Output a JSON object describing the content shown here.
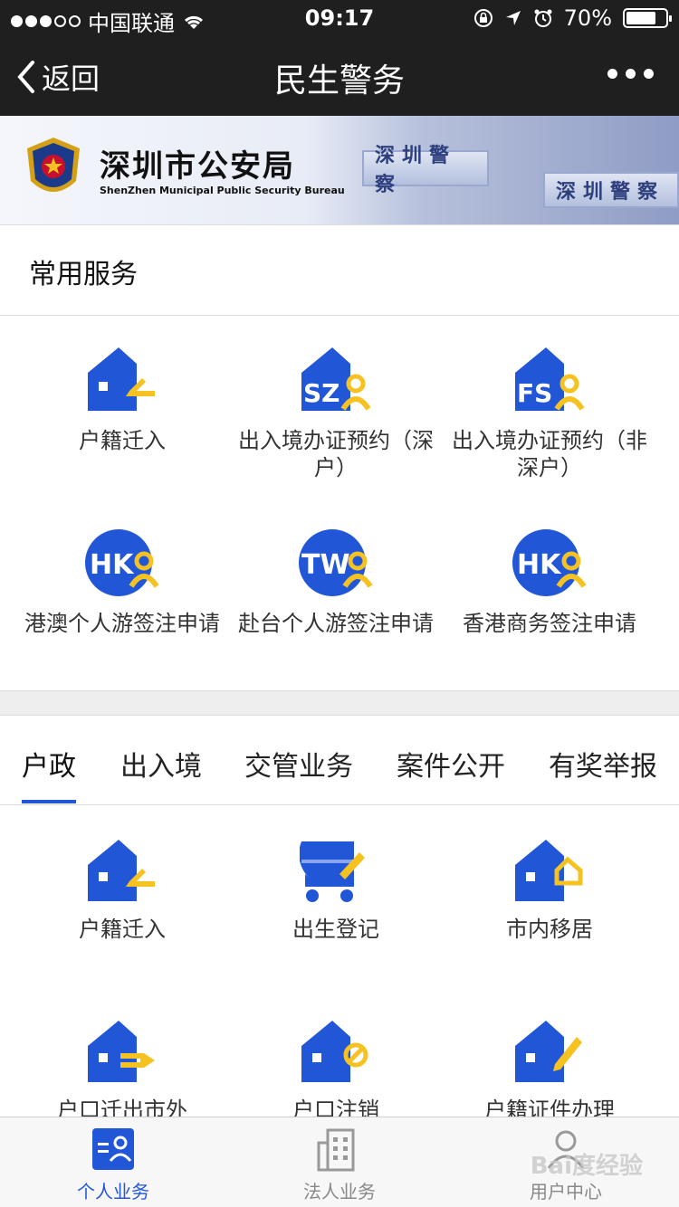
{
  "status_bar": {
    "carrier": "中国联通",
    "time": "09:17",
    "battery": "70%"
  },
  "nav": {
    "back_label": "返回",
    "title": "民生警务"
  },
  "banner": {
    "name_cn": "深圳市公安局",
    "name_en": "ShenZhen Municipal Public Security Bureau",
    "sign1": "深圳警察",
    "sign2": "深圳警察"
  },
  "common_services": {
    "title": "常用服务",
    "items": [
      {
        "label": "户籍迁入",
        "icon": "house-pen-icon"
      },
      {
        "label": "出入境办证预约（深户）",
        "icon": "sz-house-person-icon",
        "badge": "SZ"
      },
      {
        "label": "出入境办证预约（非深户）",
        "icon": "fs-house-person-icon",
        "badge": "FS"
      },
      {
        "label": "港澳个人游签注申请",
        "icon": "hk-circle-person-icon",
        "badge": "HK"
      },
      {
        "label": "赴台个人游签注申请",
        "icon": "tw-circle-person-icon",
        "badge": "TW"
      },
      {
        "label": "香港商务签注申请",
        "icon": "hk-circle-person-icon",
        "badge": "HK"
      }
    ]
  },
  "tabs": {
    "items": [
      "户政",
      "出入境",
      "交管业务",
      "案件公开",
      "有奖举报"
    ],
    "active_index": 0
  },
  "household_services": {
    "items": [
      {
        "label": "户籍迁入",
        "icon": "house-pen-icon"
      },
      {
        "label": "出生登记",
        "icon": "stroller-icon"
      },
      {
        "label": "市内移居",
        "icon": "house-home-icon"
      },
      {
        "label": "户口迁出市外",
        "icon": "house-arrow-icon"
      },
      {
        "label": "户口注销",
        "icon": "house-ban-icon"
      },
      {
        "label": "户籍证件办理",
        "icon": "house-edit-icon"
      }
    ]
  },
  "bottom_bar": {
    "items": [
      {
        "label": "个人业务",
        "icon": "person-card-icon",
        "active": true
      },
      {
        "label": "法人业务",
        "icon": "building-icon",
        "active": false
      },
      {
        "label": "用户中心",
        "icon": "user-icon",
        "active": false
      }
    ]
  },
  "watermark": "Bai度经验",
  "colors": {
    "accent_blue": "#2157d6",
    "accent_yellow": "#f5c221",
    "header_bg": "#1f1f1f"
  }
}
